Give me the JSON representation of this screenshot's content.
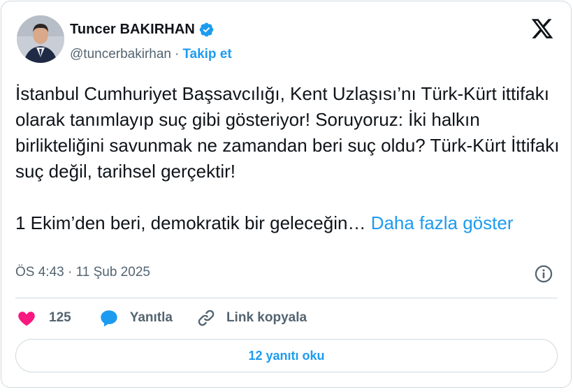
{
  "author": {
    "name": "Tuncer BAKIRHAN",
    "handle": "@tuncerbakirhan",
    "separator": "·",
    "follow_label": "Takip et",
    "verified": true
  },
  "tweet": {
    "text": "İstanbul Cumhuriyet Başsavcılığı, Kent Uzlaşısı’nı Türk-Kürt ittifakı olarak tanımlayıp suç gibi gösteriyor! Soruyoruz: İki halkın birlikteliğini savunmak ne zamandan beri suç oldu? Türk-Kürt İttifakı suç değil, tarihsel gerçektir!\n\n1 Ekim’den beri, demokratik bir geleceğin… ",
    "show_more_label": "Daha fazla göster",
    "timestamp": "ÖS 4:43 · 11 Şub 2025"
  },
  "actions": {
    "like_count": "125",
    "reply_label": "Yanıtla",
    "copy_link_label": "Link kopyala"
  },
  "read_replies_label": "12 yanıtı oku",
  "icons": [
    "verified-badge-icon",
    "x-logo-icon",
    "info-icon",
    "heart-icon",
    "reply-bubble-icon",
    "link-icon"
  ],
  "colors": {
    "accent": "#1d9bf0",
    "text": "#0f1419",
    "muted": "#536471",
    "like": "#f91880",
    "border": "#cfd9de"
  }
}
